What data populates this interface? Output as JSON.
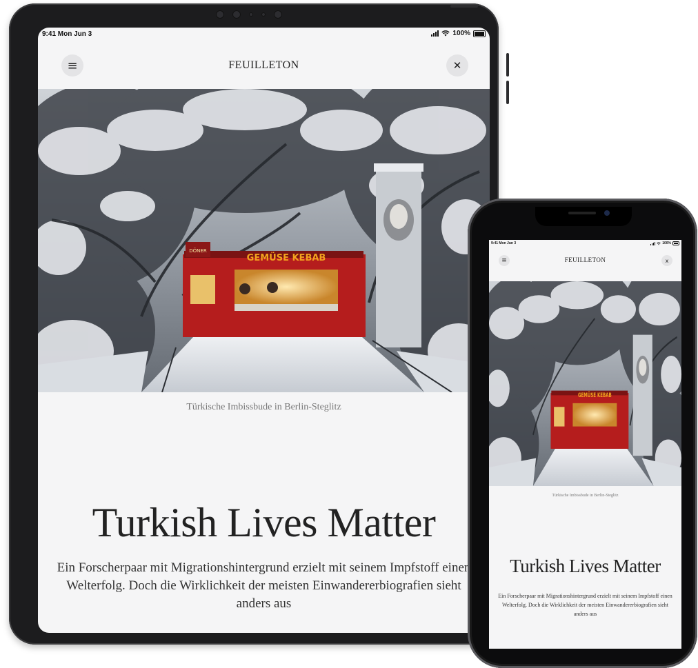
{
  "status": {
    "time": "9:41 Mon Jun 3",
    "battery": "100%"
  },
  "nav": {
    "brand": "FEUILLETON",
    "menu_icon": "≡",
    "close_icon": "✕",
    "close_icon_phone": "x"
  },
  "sign": "GEMÜSE KEBAB",
  "article": {
    "caption": "Türkische Imbissbude in Berlin-Steglitz",
    "headline": "Turkish Lives Matter",
    "dek": "Ein Forscherpaar mit Migrationshintergrund erzielt mit seinem Impfstoff einen Welterfolg. Doch die Wirklichkeit der meisten Einwandererbiografien sieht anders aus"
  },
  "colors": {
    "screen_bg": "#f5f5f6",
    "device_frame": "#1c1c1e",
    "kiosk_red": "#b51d1d",
    "sign_orange": "#f2a21e"
  }
}
